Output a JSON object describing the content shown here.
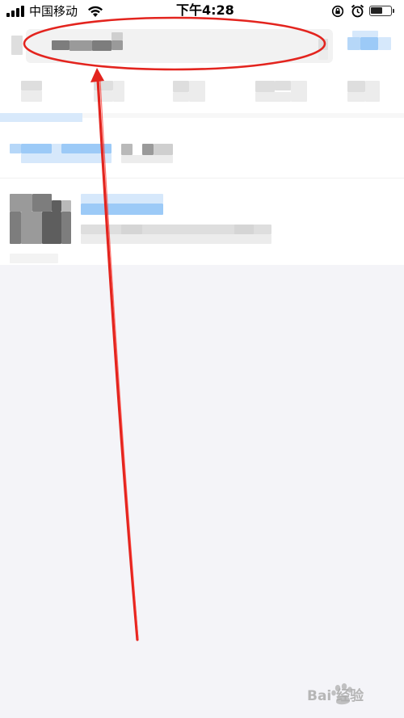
{
  "status_bar": {
    "carrier": "中国移动",
    "time": "下午4:28"
  },
  "colors": {
    "annotation_red": "#e3241e",
    "page_background": "#f4f4f8",
    "accent_blue": "#9ccaf7"
  },
  "icons": {
    "signal": "signal-icon",
    "wifi": "wifi-icon",
    "rotation_lock": "rotation-lock-icon",
    "alarm": "alarm-icon",
    "battery": "battery-icon"
  },
  "watermark": {
    "text": "Bai 经验"
  }
}
